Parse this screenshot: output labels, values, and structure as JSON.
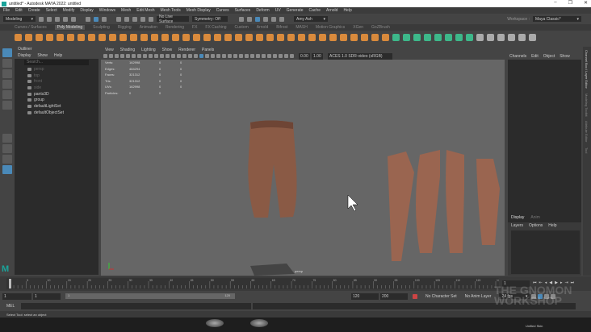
{
  "window": {
    "title": "untitled* - Autodesk MAYA 2022: untitled",
    "controls": [
      "–",
      "❐",
      "✕"
    ]
  },
  "menubar": [
    "File",
    "Edit",
    "Create",
    "Select",
    "Modify",
    "Display",
    "Windows",
    "Mesh",
    "Edit Mesh",
    "Mesh Tools",
    "Mesh Display",
    "Curves",
    "Surfaces",
    "Deform",
    "UV",
    "Generate",
    "Cache",
    "Arnold",
    "Help"
  ],
  "status": {
    "mode": "Modeling",
    "live_surface": "No Live Surface",
    "symmetry": "Symmetry: Off",
    "user": "Amy Ash",
    "workspace_label": "Workspace :",
    "workspace": "Maya Classic*"
  },
  "shelf_tabs": [
    "Curves / Surfaces",
    "Poly Modeling",
    "Sculpting",
    "Rigging",
    "Animation",
    "Rendering",
    "FX",
    "FX Caching",
    "Custom",
    "Arnold",
    "Bifrost",
    "MASH",
    "Motion Graphics",
    "XGen",
    "GoZBrush"
  ],
  "shelf_active": 1,
  "outliner": {
    "title": "Outliner",
    "menu": [
      "Display",
      "Show",
      "Help"
    ],
    "search_placeholder": "Search...",
    "items": [
      {
        "label": "persp",
        "dim": true
      },
      {
        "label": "top",
        "dim": true
      },
      {
        "label": "front",
        "dim": true
      },
      {
        "label": "side",
        "dim": true
      },
      {
        "label": "pants3D",
        "dim": false
      },
      {
        "label": "group",
        "dim": false
      },
      {
        "label": "defaultLightSet",
        "dim": false
      },
      {
        "label": "defaultObjectSet",
        "dim": false
      }
    ]
  },
  "viewport": {
    "menu": [
      "View",
      "Shading",
      "Lighting",
      "Show",
      "Renderer",
      "Panels"
    ],
    "exposure": "0.00",
    "gamma": "1.00",
    "color_space": "ACES 1.0 SDR-video (sRGB)",
    "camera": "persp",
    "hud": [
      [
        "Verts:",
        "162998",
        "0",
        "0"
      ],
      [
        "Edges:",
        "484294",
        "0",
        "0"
      ],
      [
        "Faces:",
        "321312",
        "0",
        "0"
      ],
      [
        "Tris:",
        "321312",
        "0",
        "0"
      ],
      [
        "UVs:",
        "162998",
        "0",
        "0"
      ],
      [
        "Particles:",
        "0",
        "0",
        ""
      ]
    ]
  },
  "channel_box": {
    "menu": [
      "Channels",
      "Edit",
      "Object",
      "Show"
    ],
    "layer_tabs": [
      "Display",
      "Anim"
    ],
    "layer_menu": [
      "Layers",
      "Options",
      "Help"
    ]
  },
  "side_tabs": [
    "Channel Box / Layer Editor",
    "Modeling Toolkit",
    "Attribute Editor",
    "Tool"
  ],
  "timeline": {
    "start": 1,
    "end": 120,
    "current_frame": "1"
  },
  "range": {
    "start": "1",
    "anim_start": "1",
    "slider_start": "1",
    "slider_end": "120",
    "end": "120",
    "anim_end": "200",
    "character_set": "No Character Set",
    "anim_layer": "No Anim Layer",
    "fps": "24 fps"
  },
  "mel": {
    "label": "MEL"
  },
  "help_line": "Select Tool: select an object",
  "overlay": {
    "watermark": "THE GNOMON WORKSHOP",
    "text1": "Unified Skin"
  },
  "colors": {
    "cloth": "#8a5a45",
    "accent": "#4a89b8"
  }
}
